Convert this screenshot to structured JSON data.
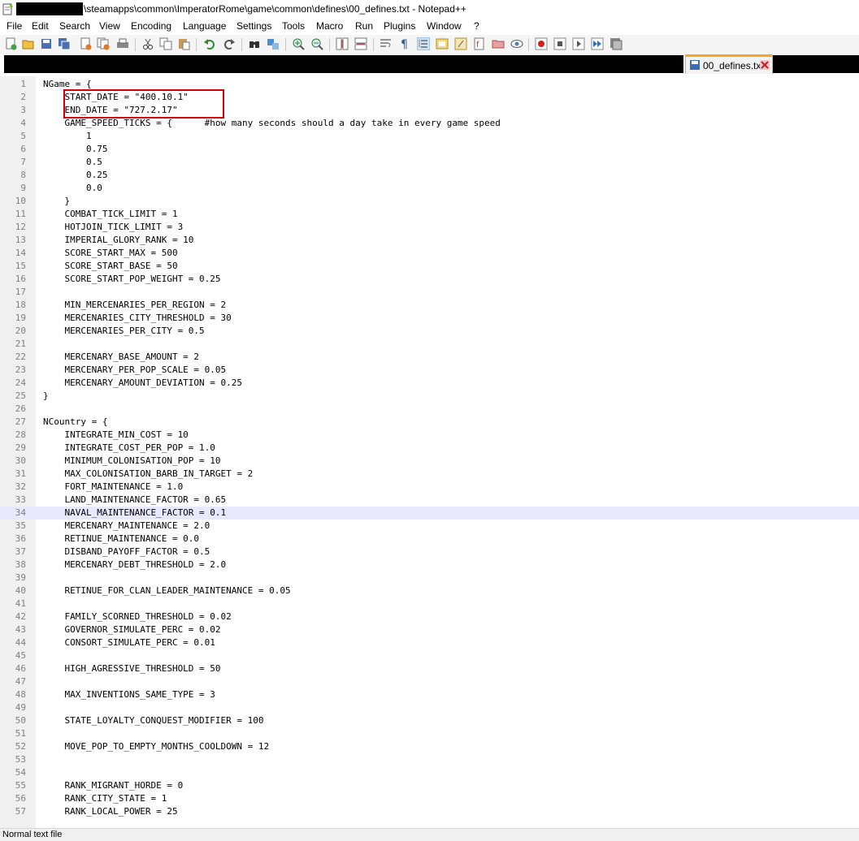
{
  "window": {
    "title": "\\steamapps\\common\\ImperatorRome\\game\\common\\defines\\00_defines.txt - Notepad++"
  },
  "menu": [
    "File",
    "Edit",
    "Search",
    "View",
    "Encoding",
    "Language",
    "Settings",
    "Tools",
    "Macro",
    "Run",
    "Plugins",
    "Window",
    "?"
  ],
  "toolbar": {
    "icons": [
      "new-file-icon",
      "open-file-icon",
      "save-icon",
      "save-all-icon",
      "close-icon",
      "close-all-icon",
      "print-icon",
      "cut-icon",
      "copy-icon",
      "paste-icon",
      "undo-icon",
      "redo-icon",
      "find-icon",
      "replace-icon",
      "zoom-in-icon",
      "zoom-out-icon",
      "sync-vertical-icon",
      "sync-horizontal-icon",
      "word-wrap-icon",
      "show-all-characters-icon",
      "indent-guide-icon",
      "document-map-icon",
      "function-list-icon",
      "folder-as-workspace-icon",
      "monitoring-icon",
      "record-macro-icon",
      "stop-recording-icon",
      "playback-macro-icon",
      "run-macro-multiple-icon",
      "save-macro-icon"
    ]
  },
  "tab": {
    "label": "00_defines.txt"
  },
  "editor": {
    "current_line": 34,
    "lines": [
      {
        "n": "1",
        "text": "NGame = {"
      },
      {
        "n": "2",
        "text": "    START_DATE = \"400.10.1\""
      },
      {
        "n": "3",
        "text": "    END_DATE = \"727.2.17\""
      },
      {
        "n": "4",
        "text": "    GAME_SPEED_TICKS = {      #how many seconds should a day take in every game speed"
      },
      {
        "n": "5",
        "text": "        1"
      },
      {
        "n": "6",
        "text": "        0.75"
      },
      {
        "n": "7",
        "text": "        0.5"
      },
      {
        "n": "8",
        "text": "        0.25"
      },
      {
        "n": "9",
        "text": "        0.0"
      },
      {
        "n": "10",
        "text": "    }"
      },
      {
        "n": "11",
        "text": "    COMBAT_TICK_LIMIT = 1"
      },
      {
        "n": "12",
        "text": "    HOTJOIN_TICK_LIMIT = 3"
      },
      {
        "n": "13",
        "text": "    IMPERIAL_GLORY_RANK = 10"
      },
      {
        "n": "14",
        "text": "    SCORE_START_MAX = 500"
      },
      {
        "n": "15",
        "text": "    SCORE_START_BASE = 50"
      },
      {
        "n": "16",
        "text": "    SCORE_START_POP_WEIGHT = 0.25"
      },
      {
        "n": "17",
        "text": ""
      },
      {
        "n": "18",
        "text": "    MIN_MERCENARIES_PER_REGION = 2"
      },
      {
        "n": "19",
        "text": "    MERCENARIES_CITY_THRESHOLD = 30"
      },
      {
        "n": "20",
        "text": "    MERCENARIES_PER_CITY = 0.5"
      },
      {
        "n": "21",
        "text": ""
      },
      {
        "n": "22",
        "text": "    MERCENARY_BASE_AMOUNT = 2"
      },
      {
        "n": "23",
        "text": "    MERCENARY_PER_POP_SCALE = 0.05"
      },
      {
        "n": "24",
        "text": "    MERCENARY_AMOUNT_DEVIATION = 0.25"
      },
      {
        "n": "25",
        "text": "}"
      },
      {
        "n": "26",
        "text": ""
      },
      {
        "n": "27",
        "text": "NCountry = {"
      },
      {
        "n": "28",
        "text": "    INTEGRATE_MIN_COST = 10"
      },
      {
        "n": "29",
        "text": "    INTEGRATE_COST_PER_POP = 1.0"
      },
      {
        "n": "30",
        "text": "    MINIMUM_COLONISATION_POP = 10"
      },
      {
        "n": "31",
        "text": "    MAX_COLONISATION_BARB_IN_TARGET = 2"
      },
      {
        "n": "32",
        "text": "    FORT_MAINTENANCE = 1.0"
      },
      {
        "n": "33",
        "text": "    LAND_MAINTENANCE_FACTOR = 0.65"
      },
      {
        "n": "34",
        "text": "    NAVAL_MAINTENANCE_FACTOR = 0.1"
      },
      {
        "n": "35",
        "text": "    MERCENARY_MAINTENANCE = 2.0"
      },
      {
        "n": "36",
        "text": "    RETINUE_MAINTENANCE = 0.0"
      },
      {
        "n": "37",
        "text": "    DISBAND_PAYOFF_FACTOR = 0.5"
      },
      {
        "n": "38",
        "text": "    MERCENARY_DEBT_THRESHOLD = 2.0"
      },
      {
        "n": "39",
        "text": ""
      },
      {
        "n": "40",
        "text": "    RETINUE_FOR_CLAN_LEADER_MAINTENANCE = 0.05"
      },
      {
        "n": "41",
        "text": ""
      },
      {
        "n": "42",
        "text": "    FAMILY_SCORNED_THRESHOLD = 0.02"
      },
      {
        "n": "43",
        "text": "    GOVERNOR_SIMULATE_PERC = 0.02"
      },
      {
        "n": "44",
        "text": "    CONSORT_SIMULATE_PERC = 0.01"
      },
      {
        "n": "45",
        "text": ""
      },
      {
        "n": "46",
        "text": "    HIGH_AGRESSIVE_THRESHOLD = 50"
      },
      {
        "n": "47",
        "text": ""
      },
      {
        "n": "48",
        "text": "    MAX_INVENTIONS_SAME_TYPE = 3"
      },
      {
        "n": "49",
        "text": ""
      },
      {
        "n": "50",
        "text": "    STATE_LOYALTY_CONQUEST_MODIFIER = 100"
      },
      {
        "n": "51",
        "text": ""
      },
      {
        "n": "52",
        "text": "    MOVE_POP_TO_EMPTY_MONTHS_COOLDOWN = 12"
      },
      {
        "n": "53",
        "text": ""
      },
      {
        "n": "54",
        "text": ""
      },
      {
        "n": "55",
        "text": "    RANK_MIGRANT_HORDE = 0"
      },
      {
        "n": "56",
        "text": "    RANK_CITY_STATE = 1"
      },
      {
        "n": "57",
        "text": "    RANK_LOCAL_POWER = 25"
      }
    ]
  },
  "status": {
    "text": "Normal text file"
  },
  "colors": {
    "current_line": "#e8e8ff",
    "annotation_box": "#d40000",
    "tab_accent": "#f4a623"
  }
}
